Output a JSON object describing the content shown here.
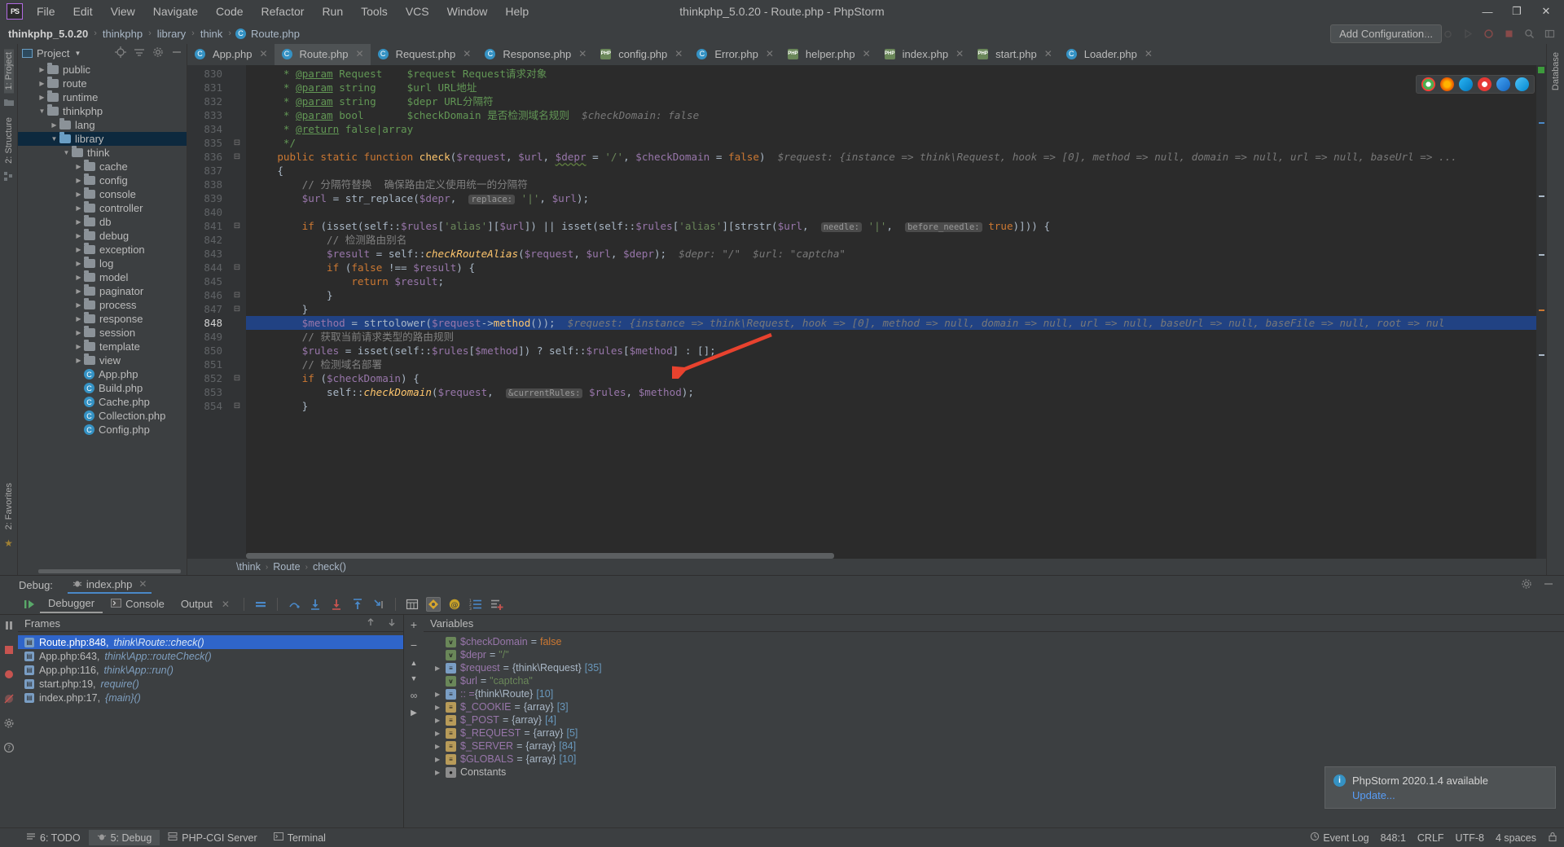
{
  "titlebar": {
    "logo": "PS",
    "window_title": "thinkphp_5.0.20 - Route.php - PhpStorm",
    "menus": [
      "File",
      "Edit",
      "View",
      "Navigate",
      "Code",
      "Refactor",
      "Run",
      "Tools",
      "VCS",
      "Window",
      "Help"
    ],
    "minimize": "—",
    "maximize": "❐",
    "close": "✕"
  },
  "navbar": {
    "crumbs": [
      "thinkphp_5.0.20",
      "thinkphp",
      "library",
      "think",
      "Route.php"
    ],
    "separator": "›",
    "add_configuration": "Add Configuration...",
    "icons": [
      "run-icon",
      "debug-icon",
      "coverage-icon",
      "profile-icon",
      "stop-icon",
      "search-icon",
      "layout-icon"
    ]
  },
  "rail_left": {
    "project_tab": "1: Project",
    "structure_tab": "2: Structure",
    "favorites_tab": "2: Favorites"
  },
  "project_panel": {
    "title": "Project",
    "header_icons": [
      "target-icon",
      "collapse-all-icon",
      "gear-icon",
      "hide-icon"
    ],
    "tree": [
      {
        "indent": 1,
        "arrow": "▶",
        "type": "folder",
        "label": "public",
        "selected": false
      },
      {
        "indent": 1,
        "arrow": "▶",
        "type": "folder",
        "label": "route",
        "selected": false
      },
      {
        "indent": 1,
        "arrow": "▶",
        "type": "folder",
        "label": "runtime",
        "selected": false
      },
      {
        "indent": 1,
        "arrow": "▼",
        "type": "folder",
        "label": "thinkphp",
        "selected": false
      },
      {
        "indent": 2,
        "arrow": "▶",
        "type": "folder",
        "label": "lang",
        "selected": false
      },
      {
        "indent": 2,
        "arrow": "▼",
        "type": "folder-blue",
        "label": "library",
        "selected": true
      },
      {
        "indent": 3,
        "arrow": "▼",
        "type": "folder",
        "label": "think",
        "selected": false
      },
      {
        "indent": 4,
        "arrow": "▶",
        "type": "folder",
        "label": "cache",
        "selected": false
      },
      {
        "indent": 4,
        "arrow": "▶",
        "type": "folder",
        "label": "config",
        "selected": false
      },
      {
        "indent": 4,
        "arrow": "▶",
        "type": "folder",
        "label": "console",
        "selected": false
      },
      {
        "indent": 4,
        "arrow": "▶",
        "type": "folder",
        "label": "controller",
        "selected": false
      },
      {
        "indent": 4,
        "arrow": "▶",
        "type": "folder",
        "label": "db",
        "selected": false
      },
      {
        "indent": 4,
        "arrow": "▶",
        "type": "folder",
        "label": "debug",
        "selected": false
      },
      {
        "indent": 4,
        "arrow": "▶",
        "type": "folder",
        "label": "exception",
        "selected": false
      },
      {
        "indent": 4,
        "arrow": "▶",
        "type": "folder",
        "label": "log",
        "selected": false
      },
      {
        "indent": 4,
        "arrow": "▶",
        "type": "folder",
        "label": "model",
        "selected": false
      },
      {
        "indent": 4,
        "arrow": "▶",
        "type": "folder",
        "label": "paginator",
        "selected": false
      },
      {
        "indent": 4,
        "arrow": "▶",
        "type": "folder",
        "label": "process",
        "selected": false
      },
      {
        "indent": 4,
        "arrow": "▶",
        "type": "folder",
        "label": "response",
        "selected": false
      },
      {
        "indent": 4,
        "arrow": "▶",
        "type": "folder",
        "label": "session",
        "selected": false
      },
      {
        "indent": 4,
        "arrow": "▶",
        "type": "folder",
        "label": "template",
        "selected": false
      },
      {
        "indent": 4,
        "arrow": "▶",
        "type": "folder",
        "label": "view",
        "selected": false
      },
      {
        "indent": 4,
        "arrow": "",
        "type": "php",
        "label": "App.php",
        "selected": false
      },
      {
        "indent": 4,
        "arrow": "",
        "type": "php",
        "label": "Build.php",
        "selected": false
      },
      {
        "indent": 4,
        "arrow": "",
        "type": "php",
        "label": "Cache.php",
        "selected": false
      },
      {
        "indent": 4,
        "arrow": "",
        "type": "php",
        "label": "Collection.php",
        "selected": false
      },
      {
        "indent": 4,
        "arrow": "",
        "type": "php",
        "label": "Config.php",
        "selected": false
      }
    ]
  },
  "editor_tabs": [
    {
      "label": "App.php",
      "icon": "php-class-icon",
      "active": false
    },
    {
      "label": "Route.php",
      "icon": "php-class-icon",
      "active": true
    },
    {
      "label": "Request.php",
      "icon": "php-class-icon",
      "active": false
    },
    {
      "label": "Response.php",
      "icon": "php-class-icon",
      "active": false
    },
    {
      "label": "config.php",
      "icon": "php-file-icon",
      "active": false
    },
    {
      "label": "Error.php",
      "icon": "php-class-icon",
      "active": false
    },
    {
      "label": "helper.php",
      "icon": "php-file-icon",
      "active": false
    },
    {
      "label": "index.php",
      "icon": "php-file-icon",
      "active": false
    },
    {
      "label": "start.php",
      "icon": "php-file-icon",
      "active": false
    },
    {
      "label": "Loader.php",
      "icon": "php-class-icon",
      "active": false
    }
  ],
  "code": {
    "first_line": 830,
    "current_line": 848,
    "lines": [
      {
        "n": 830,
        "fold": "",
        "highlight": false,
        "html": "     <span class='t-doc'>*</span> <span class='t-doctag'>@param</span> <span class='t-doc'>Request    $request Request请求对象</span>"
      },
      {
        "n": 831,
        "fold": "",
        "highlight": false,
        "html": "     <span class='t-doc'>*</span> <span class='t-doctag'>@param</span> <span class='t-doc'>string     $url URL地址</span>"
      },
      {
        "n": 832,
        "fold": "",
        "highlight": false,
        "html": "     <span class='t-doc'>*</span> <span class='t-doctag'>@param</span> <span class='t-doc'>string     $depr URL分隔符</span>"
      },
      {
        "n": 833,
        "fold": "",
        "highlight": false,
        "html": "     <span class='t-doc'>*</span> <span class='t-doctag'>@param</span> <span class='t-doc'>bool       $checkDomain 是否检测域名规则</span>  <span class='t-hint'>$checkDomain: false</span>"
      },
      {
        "n": 834,
        "fold": "",
        "highlight": false,
        "html": "     <span class='t-doc'>*</span> <span class='t-doctag'>@return</span> <span class='t-doc'>false|array</span>"
      },
      {
        "n": 835,
        "fold": "⊟",
        "highlight": false,
        "html": "     <span class='t-doc'>*/</span>"
      },
      {
        "n": 836,
        "fold": "⊟",
        "highlight": false,
        "html": "    <span class='t-kw'>public static function</span> <span class='t-fn'>check</span><span class='t-plain'>(</span><span class='t-var'>$request</span><span class='t-plain'>, </span><span class='t-var'>$url</span><span class='t-plain'>, </span><span class='t-var t-wavy'>$depr</span> <span class='t-plain'>=</span> <span class='t-str'>'/'</span><span class='t-plain'>, </span><span class='t-var'>$checkDomain</span> <span class='t-plain'>=</span> <span class='t-kw'>false</span><span class='t-plain'>)</span>  <span class='t-hint'>$request: {instance =&gt; think\\Request, hook =&gt; [0], method =&gt; null, domain =&gt; null, url =&gt; null, baseUrl =&gt; ...</span>"
      },
      {
        "n": 837,
        "fold": "",
        "highlight": false,
        "html": "    <span class='t-plain'>{</span>"
      },
      {
        "n": 838,
        "fold": "",
        "highlight": false,
        "html": "        <span class='t-cmt'>// 分隔符替换  确保路由定义使用统一的分隔符</span>"
      },
      {
        "n": 839,
        "fold": "",
        "highlight": false,
        "html": "        <span class='t-var'>$url</span> <span class='t-plain'>=</span> <span class='t-plain'>str_replace(</span><span class='t-var'>$depr</span><span class='t-plain'>, </span> <span class='t-param'>replace:</span> <span class='t-str'>'|'</span><span class='t-plain'>, </span><span class='t-var'>$url</span><span class='t-plain'>);</span>"
      },
      {
        "n": 840,
        "fold": "",
        "highlight": false,
        "html": ""
      },
      {
        "n": 841,
        "fold": "⊟",
        "highlight": false,
        "html": "        <span class='t-kw'>if</span> <span class='t-plain'>(isset(self::</span><span class='t-var'>$rules</span><span class='t-plain'>[</span><span class='t-str'>'alias'</span><span class='t-plain'>][</span><span class='t-var'>$url</span><span class='t-plain'>]) || isset(self::</span><span class='t-var'>$rules</span><span class='t-plain'>[</span><span class='t-str'>'alias'</span><span class='t-plain'>][strstr(</span><span class='t-var'>$url</span><span class='t-plain'>, </span> <span class='t-param'>needle:</span> <span class='t-str'>'|'</span><span class='t-plain'>, </span> <span class='t-param'>before_needle:</span> <span class='t-kw'>true</span><span class='t-plain'>)])) {</span>"
      },
      {
        "n": 842,
        "fold": "",
        "highlight": false,
        "html": "            <span class='t-cmt'>// 检测路由别名</span>"
      },
      {
        "n": 843,
        "fold": "",
        "highlight": false,
        "html": "            <span class='t-var'>$result</span> <span class='t-plain'>= self::</span><span class='t-fn' style='font-style:italic'>checkRouteAlias</span><span class='t-plain'>(</span><span class='t-var'>$request</span><span class='t-plain'>, </span><span class='t-var'>$url</span><span class='t-plain'>, </span><span class='t-var'>$depr</span><span class='t-plain'>);</span>  <span class='t-hint'>$depr: \"/\"  $url: \"captcha\"</span>"
      },
      {
        "n": 844,
        "fold": "⊟",
        "highlight": false,
        "html": "            <span class='t-kw'>if</span> <span class='t-plain'>(</span><span class='t-kw'>false</span> <span class='t-plain'>!==</span> <span class='t-var'>$result</span><span class='t-plain'>) {</span>"
      },
      {
        "n": 845,
        "fold": "",
        "highlight": false,
        "html": "                <span class='t-kw'>return</span> <span class='t-var'>$result</span><span class='t-plain'>;</span>"
      },
      {
        "n": 846,
        "fold": "⊟",
        "highlight": false,
        "html": "            <span class='t-plain'>}</span>"
      },
      {
        "n": 847,
        "fold": "⊟",
        "highlight": false,
        "html": "        <span class='t-plain'>}</span>"
      },
      {
        "n": 848,
        "fold": "",
        "highlight": true,
        "html": "        <span class='t-var'>$method</span> <span class='t-plain'>=</span> <span class='t-plain'>strtolower(</span><span class='t-var'>$request</span><span class='t-plain'>-&gt;</span><span class='t-fn'>method</span><span class='t-plain'>());</span>  <span class='t-hint'>$request: {instance =&gt; think\\Request, hook =&gt; [0], method =&gt; null, domain =&gt; null, url =&gt; null, baseUrl =&gt; null, baseFile =&gt; null, root =&gt; nul</span>"
      },
      {
        "n": 849,
        "fold": "",
        "highlight": false,
        "html": "        <span class='t-cmt'>// 获取当前请求类型的路由规则</span>"
      },
      {
        "n": 850,
        "fold": "",
        "highlight": false,
        "html": "        <span class='t-var'>$rules</span> <span class='t-plain'>= isset(self::</span><span class='t-var'>$rules</span><span class='t-plain'>[</span><span class='t-var'>$method</span><span class='t-plain'>]) ? self::</span><span class='t-var'>$rules</span><span class='t-plain'>[</span><span class='t-var'>$method</span><span class='t-plain'>] : [];</span>"
      },
      {
        "n": 851,
        "fold": "",
        "highlight": false,
        "html": "        <span class='t-cmt'>// 检测域名部署</span>"
      },
      {
        "n": 852,
        "fold": "⊟",
        "highlight": false,
        "html": "        <span class='t-kw'>if</span> <span class='t-plain'>(</span><span class='t-var'>$checkDomain</span><span class='t-plain'>) {</span>"
      },
      {
        "n": 853,
        "fold": "",
        "highlight": false,
        "html": "            <span class='t-plain'>self::</span><span class='t-fn' style='font-style:italic'>checkDomain</span><span class='t-plain'>(</span><span class='t-var'>$request</span><span class='t-plain'>, </span> <span class='t-param'>&amp;currentRules:</span> <span class='t-var'>$rules</span><span class='t-plain'>, </span><span class='t-var'>$method</span><span class='t-plain'>);</span>"
      },
      {
        "n": 854,
        "fold": "⊟",
        "highlight": false,
        "html": "        <span class='t-plain'>}</span>"
      }
    ],
    "breadcrumb": [
      "\\think",
      "Route",
      "check()"
    ],
    "breadcrumb_sep": "›"
  },
  "browser_icons": [
    "chrome-icon",
    "firefox-icon",
    "edge-icon",
    "opera-icon",
    "safari-icon",
    "ie-icon"
  ],
  "debug": {
    "label": "Debug:",
    "session": "index.php",
    "tabs": [
      {
        "label": "Debugger",
        "active": true,
        "icon": ""
      },
      {
        "label": "Console",
        "active": false,
        "icon": "console-icon"
      },
      {
        "label": "Output",
        "active": false,
        "icon": ""
      }
    ],
    "toolbar_icons": [
      "resume-icon",
      "mute-breakpoints-icon",
      "step-over-icon",
      "step-into-icon",
      "force-step-into-icon",
      "step-out-icon",
      "run-to-cursor-icon",
      "evaluate-icon",
      "settings-icon",
      "watches-icon",
      "add-watch-icon"
    ],
    "frames_header": "Frames",
    "frames_icons": [
      "up-arrow-icon",
      "down-arrow-icon"
    ],
    "frames": [
      {
        "file": "Route.php:848,",
        "context": "think\\Route::check()",
        "selected": true
      },
      {
        "file": "App.php:643,",
        "context": "think\\App::routeCheck()",
        "selected": false
      },
      {
        "file": "App.php:116,",
        "context": "think\\App::run()",
        "selected": false
      },
      {
        "file": "start.php:19,",
        "context": "require()",
        "selected": false
      },
      {
        "file": "index.php:17,",
        "context": "{main}()",
        "selected": false
      }
    ],
    "variables_header": "Variables",
    "variables": [
      {
        "expand": "",
        "icon": "v",
        "name": "$checkDomain",
        "eq": "=",
        "value": "false",
        "vtype": "kw",
        "count": ""
      },
      {
        "expand": "",
        "icon": "v",
        "name": "$depr",
        "eq": "=",
        "value": "\"/\"",
        "vtype": "str",
        "count": ""
      },
      {
        "expand": "▶",
        "icon": "o",
        "name": "$request",
        "eq": "=",
        "value": "{think\\Request}",
        "vtype": "obj",
        "count": "[35]"
      },
      {
        "expand": "",
        "icon": "v",
        "name": "$url",
        "eq": "=",
        "value": "\"captcha\"",
        "vtype": "str",
        "count": ""
      },
      {
        "expand": "▶",
        "icon": "o",
        "name": ":: =",
        "eq": "",
        "value": "{think\\Route}",
        "vtype": "obj",
        "count": "[10]"
      },
      {
        "expand": "▶",
        "icon": "a",
        "name": "$_COOKIE",
        "eq": "=",
        "value": "{array}",
        "vtype": "obj",
        "count": "[3]"
      },
      {
        "expand": "▶",
        "icon": "a",
        "name": "$_POST",
        "eq": "=",
        "value": "{array}",
        "vtype": "obj",
        "count": "[4]"
      },
      {
        "expand": "▶",
        "icon": "a",
        "name": "$_REQUEST",
        "eq": "=",
        "value": "{array}",
        "vtype": "obj",
        "count": "[5]"
      },
      {
        "expand": "▶",
        "icon": "a",
        "name": "$_SERVER",
        "eq": "=",
        "value": "{array}",
        "vtype": "obj",
        "count": "[84]"
      },
      {
        "expand": "▶",
        "icon": "a",
        "name": "$GLOBALS",
        "eq": "=",
        "value": "{array}",
        "vtype": "obj",
        "count": "[10]"
      },
      {
        "expand": "▶",
        "icon": "c",
        "name": "Constants",
        "eq": "",
        "value": "",
        "vtype": "plain",
        "count": ""
      }
    ]
  },
  "notification": {
    "title": "PhpStorm 2020.1.4 available",
    "link": "Update..."
  },
  "statusbar": {
    "items": [
      {
        "label": "6: TODO",
        "icon": "todo-icon",
        "active": false
      },
      {
        "label": "5: Debug",
        "icon": "debug-icon",
        "active": true
      },
      {
        "label": "PHP-CGI Server",
        "icon": "server-icon",
        "active": false
      },
      {
        "label": "Terminal",
        "icon": "terminal-icon",
        "active": false
      }
    ],
    "event_log": "Event Log",
    "caret": "848:1",
    "line_sep": "CRLF",
    "encoding": "UTF-8",
    "indent": "4 spaces",
    "lock_icon": "lock-icon"
  },
  "colors": {
    "accent_blue": "#4a88c7",
    "selection_blue": "#214283",
    "frame_selected": "#2f65ca",
    "tree_selected": "#0d293e",
    "panel_bg": "#3c3f41",
    "editor_bg": "#2b2b2b",
    "arrow_red": "#e8422e"
  }
}
